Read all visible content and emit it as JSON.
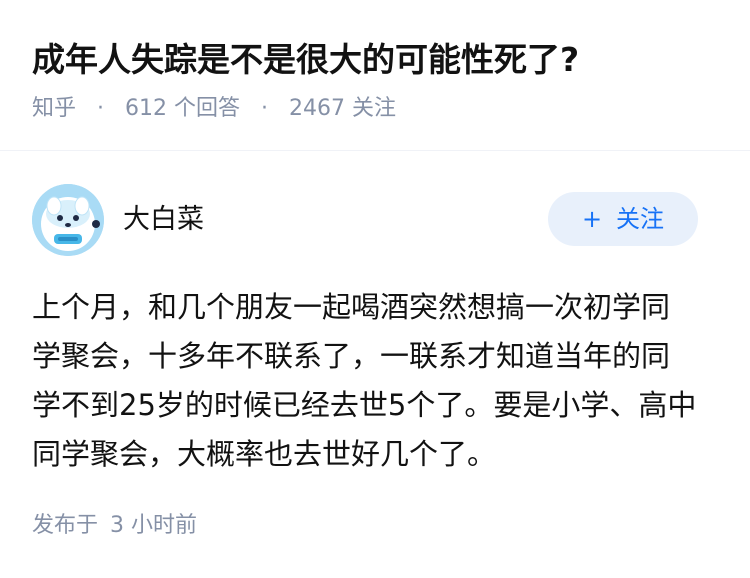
{
  "question": {
    "title": "成年人失踪是不是很大的可能性死了?",
    "source": "知乎",
    "answers_count": "612",
    "answers_label": "个回答",
    "followers_count": "2467",
    "followers_label": "关注"
  },
  "answer": {
    "author": {
      "name": "大白菜",
      "avatar_icon": "cartoon-avatar-icon"
    },
    "follow_button": {
      "icon": "plus-icon",
      "label": "关注"
    },
    "content_lines": [
      "上个月，和几个朋友一起喝酒突然想搞一次初学同",
      "学聚会，十多年不联系了，一联系才知道当年的同",
      "学不到25岁的时候已经去世5个了。要是小学、高中",
      "同学聚会，大概率也去世好几个了。"
    ],
    "published_prefix": "发布于",
    "published_time": "3 小时前"
  },
  "colors": {
    "meta_text": "#8590a6",
    "accent": "#1772f6",
    "follow_bg": "#e8f0fb",
    "avatar_bg": "#a9dbf5"
  }
}
